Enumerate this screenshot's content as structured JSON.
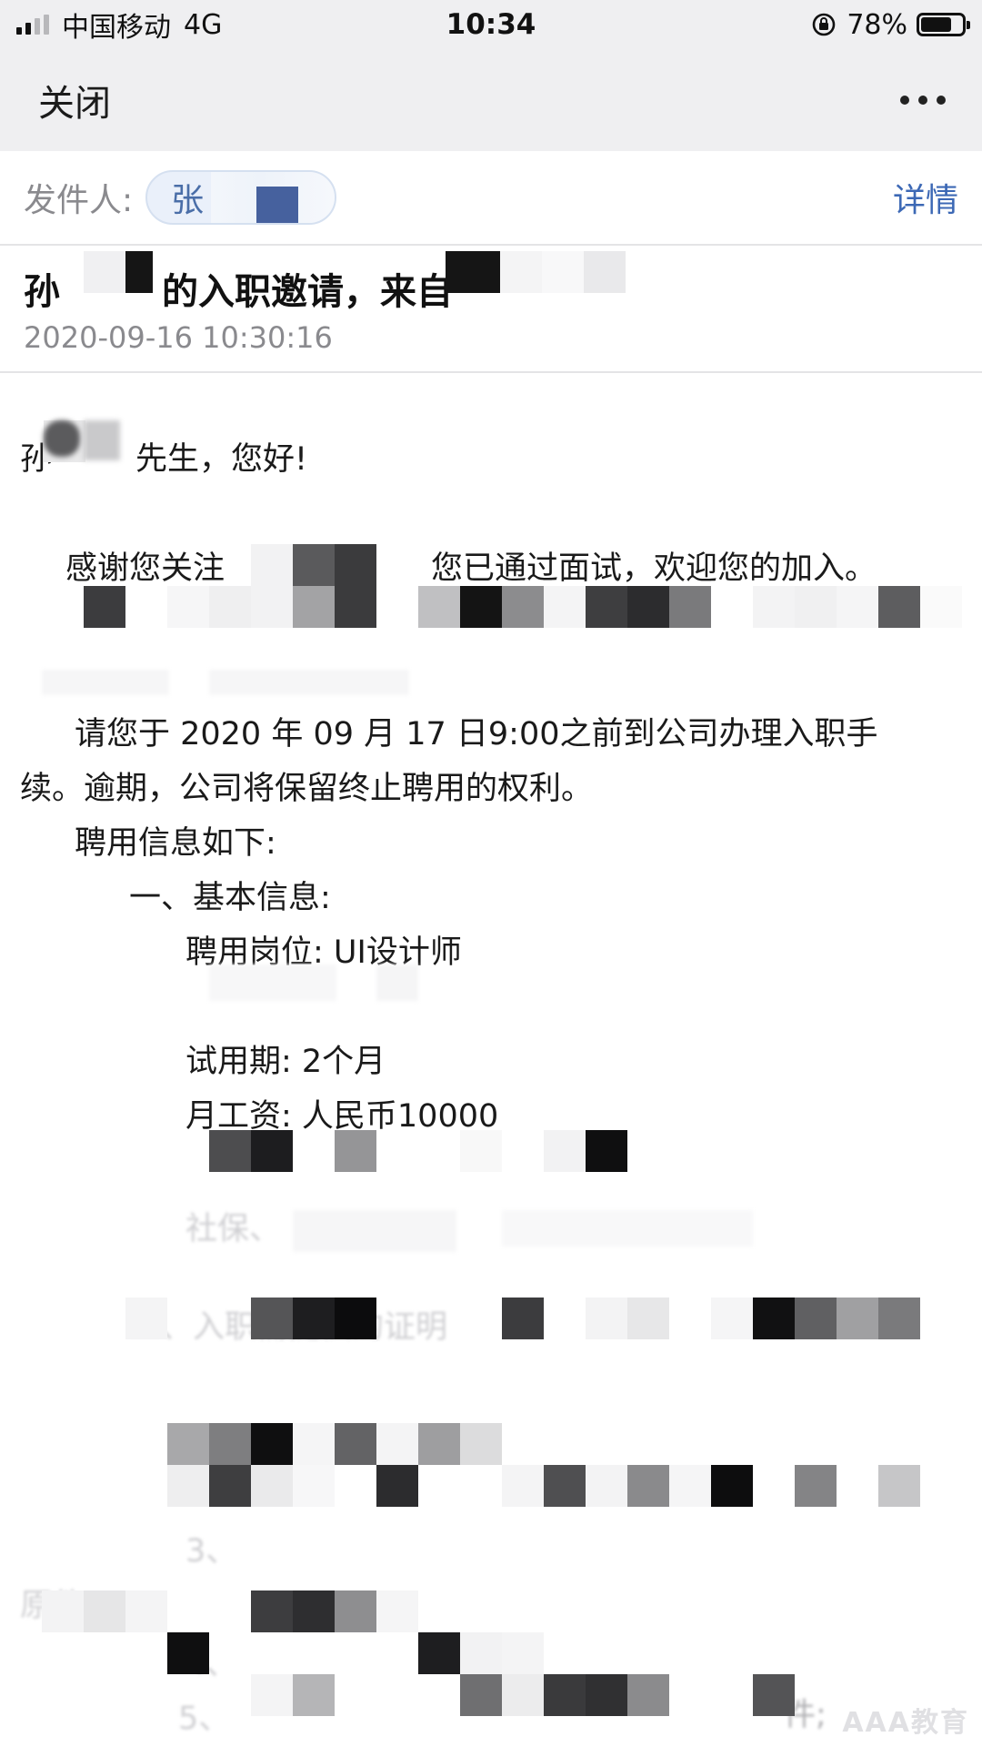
{
  "status_bar": {
    "carrier": "中国移动",
    "network": "4G",
    "time": "10:34",
    "battery_text": "78%",
    "battery_level": 0.78
  },
  "nav": {
    "close_label": "关闭",
    "more_icon": "more-horizontal-icon"
  },
  "sender": {
    "label": "发件人:",
    "name_visible": "张",
    "detail_label": "详情"
  },
  "email": {
    "subject_part1": "孙",
    "subject_part2": "的入职邀请，来自",
    "date": "2020-09-16 10:30:16"
  },
  "body": {
    "greeting_start": "孙",
    "greeting_end": "先生，您好!",
    "thanks_start": "感谢您关注",
    "thanks_end": "您已通过面试，欢迎您的加入。",
    "report_line1": "请您于 2020 年  09  月  17  日9:00之前到公司办理入职手",
    "report_line2": "续。逾期，公司将保留终止聘用的权利。",
    "info_heading": "聘用信息如下:",
    "section1_title": "一、基本信息:",
    "position": "聘用岗位:   UI设计师",
    "probation": "试用期: 2个月",
    "salary": "月工资: 人民币10000",
    "ghost_social": "社保、",
    "ghost_section2": "二、入职需提供的证明",
    "ghost_item3": "3、",
    "ghost_original": "原件",
    "ghost_item4": "4、",
    "ghost_item5": "5、",
    "ghost_attach": "件;"
  },
  "watermark": "AAA教育"
}
